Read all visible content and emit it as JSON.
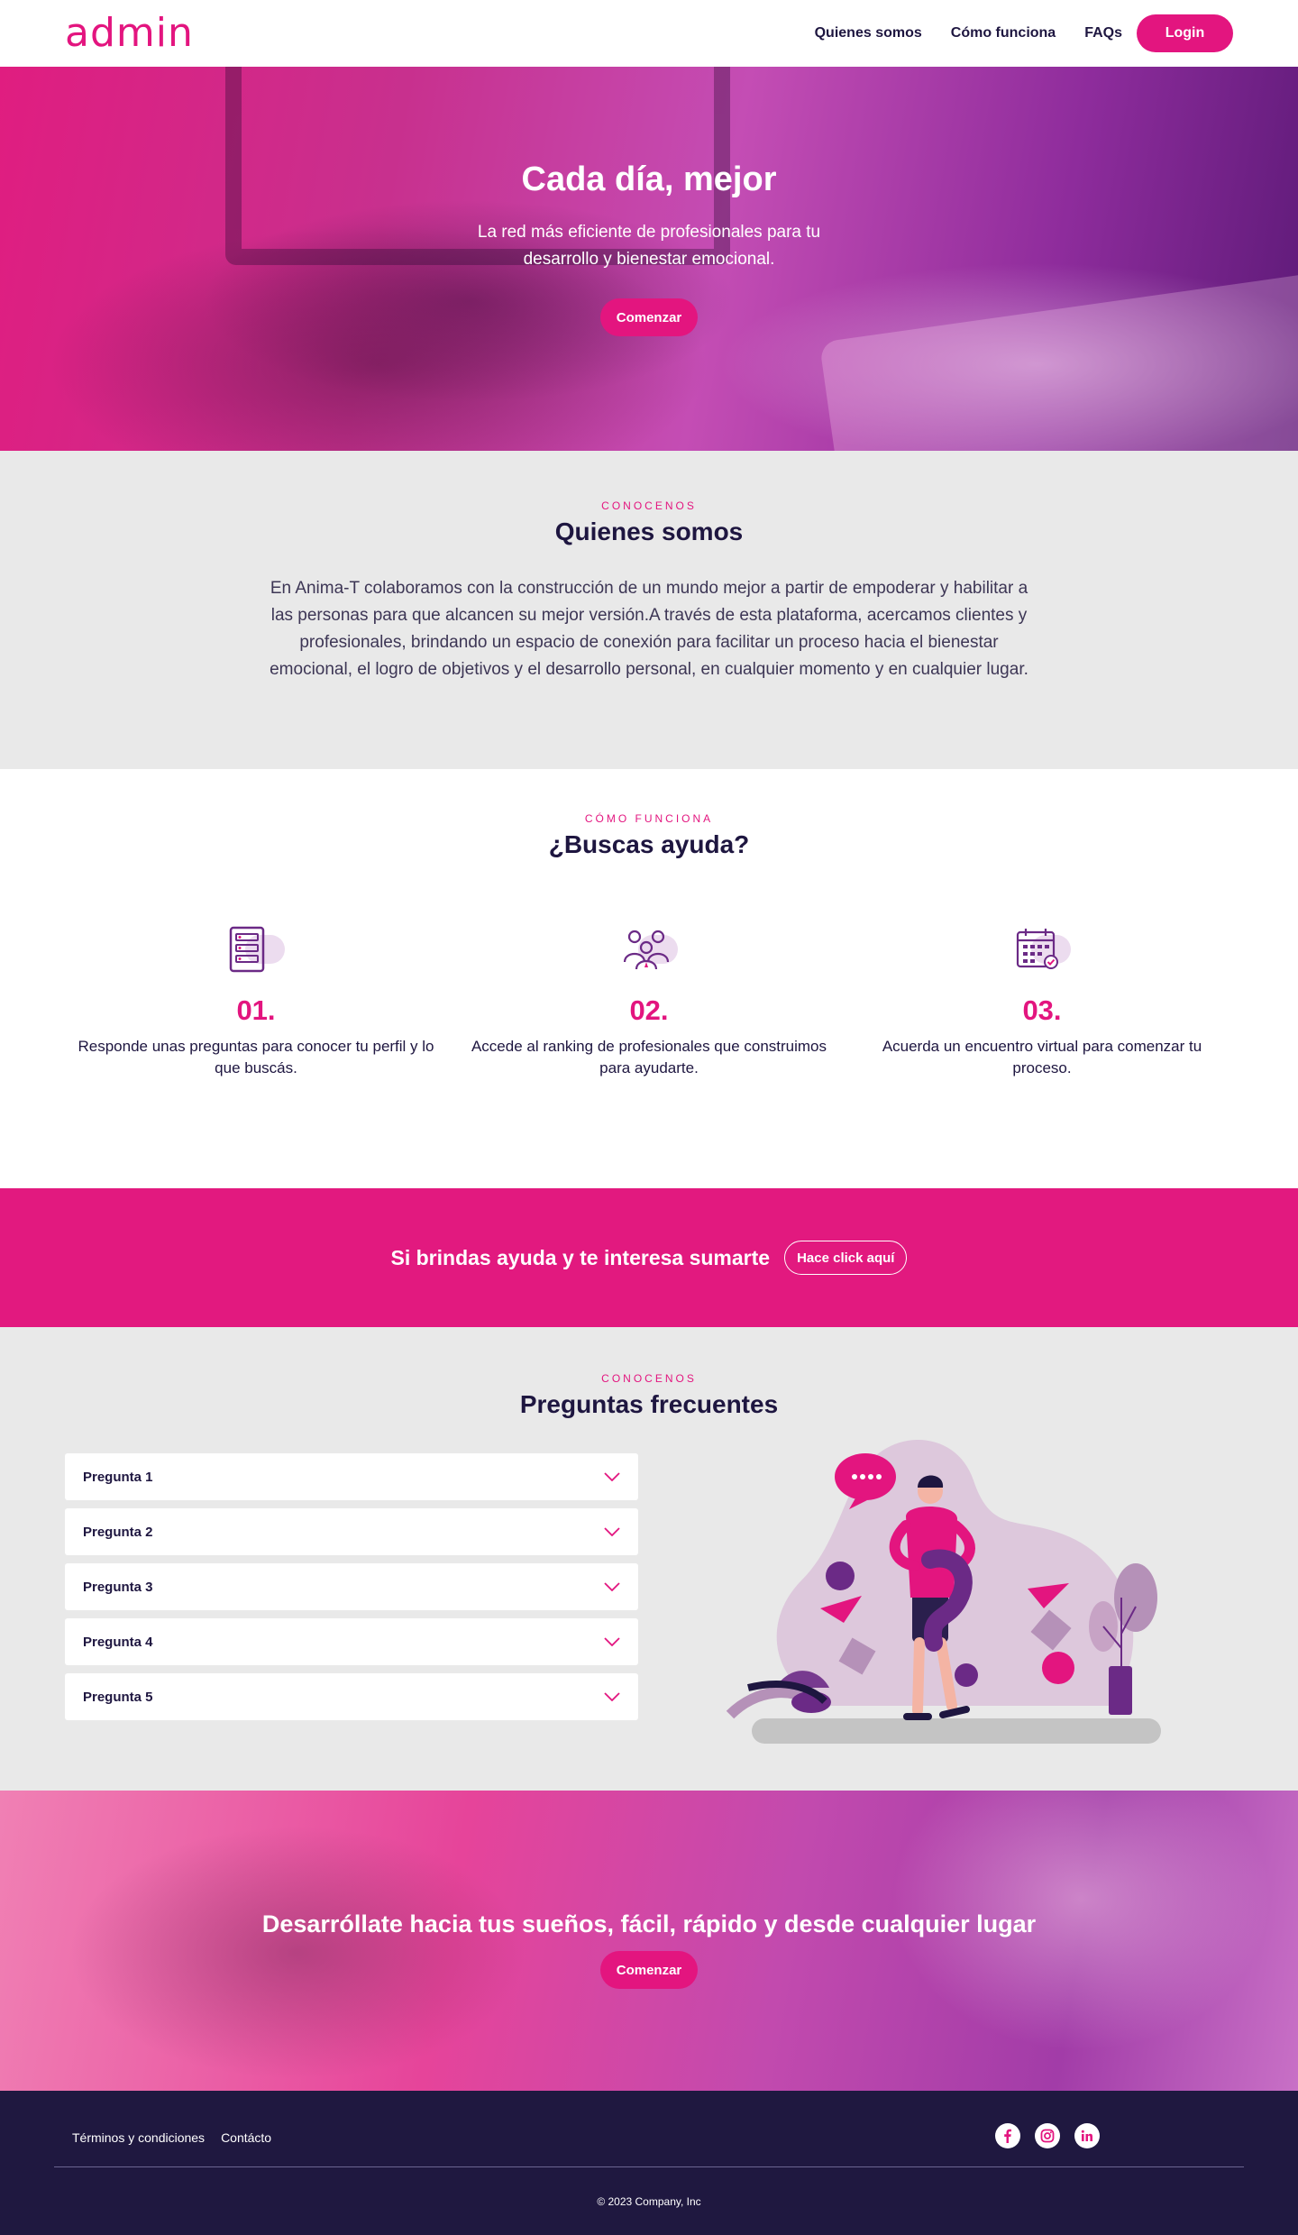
{
  "nav": {
    "logo": "admin",
    "links": [
      "Quienes somos",
      "Cómo funciona",
      "FAQs"
    ],
    "login": "Login"
  },
  "hero": {
    "title": "Cada día, mejor",
    "subtitle": "La red más eficiente de profesionales para tu desarrollo y bienestar emocional.",
    "cta": "Comenzar"
  },
  "about": {
    "eyebrow": "CONOCENOS",
    "title": "Quienes somos",
    "text": "En Anima-T colaboramos con la construcción de un mundo mejor a partir de empoderar y habilitar a las personas para que alcancen su mejor versión.A través de esta plataforma, acercamos clientes y profesionales, brindando un espacio de conexión para facilitar un proceso hacia el bienestar emocional, el logro de objetivos y el desarrollo personal, en cualquier momento y en cualquier lugar."
  },
  "how": {
    "eyebrow": "CÓMO FUNCIONA",
    "title": "¿Buscas ayuda?",
    "steps": [
      {
        "num": "01.",
        "text": "Responde unas preguntas para conocer tu perfil y lo que buscás.",
        "icon": "form-icon"
      },
      {
        "num": "02.",
        "text": "Accede al ranking de profesionales que construimos para ayudarte.",
        "icon": "professionals-icon"
      },
      {
        "num": "03.",
        "text": "Acuerda un encuentro virtual para comenzar tu proceso.",
        "icon": "calendar-icon"
      }
    ]
  },
  "join": {
    "text": "Si brindas ayuda y te interesa sumarte",
    "button": "Hace click aquí"
  },
  "faq": {
    "eyebrow": "CONOCENOS",
    "title": "Preguntas frecuentes",
    "items": [
      "Pregunta 1",
      "Pregunta 2",
      "Pregunta 3",
      "Pregunta 4",
      "Pregunta 5"
    ]
  },
  "bottom": {
    "title": "Desarróllate hacia tus sueños, fácil, rápido y desde cualquier lugar",
    "cta": "Comenzar"
  },
  "footer": {
    "links": [
      "Términos y condiciones",
      "Contácto"
    ],
    "socials": [
      "facebook-icon",
      "instagram-icon",
      "linkedin-icon"
    ],
    "copyright": "© 2023 Company, Inc"
  },
  "colors": {
    "accent": "#e3157f",
    "dark": "#1e1640",
    "purple": "#6b2a86",
    "gray_bg": "#e9e9e9",
    "footer_bg": "#1f1840"
  }
}
